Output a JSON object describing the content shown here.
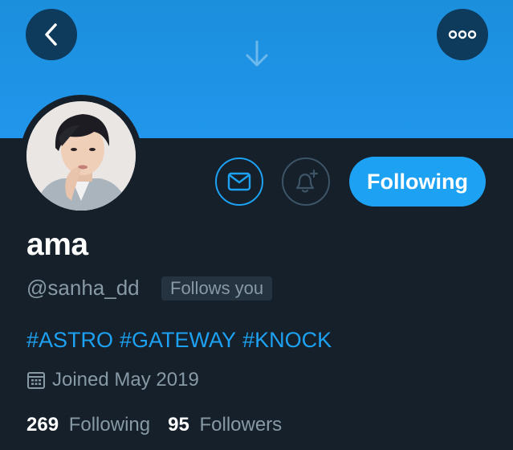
{
  "header": {
    "back_icon": "chevron-left-icon",
    "more_icon": "more-horizontal-icon",
    "pull_icon": "arrow-down-icon",
    "banner_color": "#1d97e8"
  },
  "avatar": {
    "icon": "profile-photo"
  },
  "actions": {
    "message_icon": "envelope-icon",
    "notify_icon": "bell-plus-icon",
    "following_label": "Following"
  },
  "profile": {
    "display_name": "ama",
    "handle": "@sanha_dd",
    "follows_you": "Follows you",
    "bio_hashtags": [
      "#ASTRO",
      "#GATEWAY",
      "#KNOCK"
    ],
    "joined": "Joined May 2019",
    "joined_icon": "calendar-icon"
  },
  "stats": {
    "following_count": "269",
    "following_label": "Following",
    "followers_count": "95",
    "followers_label": "Followers"
  },
  "colors": {
    "background": "#15202b",
    "accent": "#1da1f2",
    "secondary_text": "#8899a6"
  }
}
